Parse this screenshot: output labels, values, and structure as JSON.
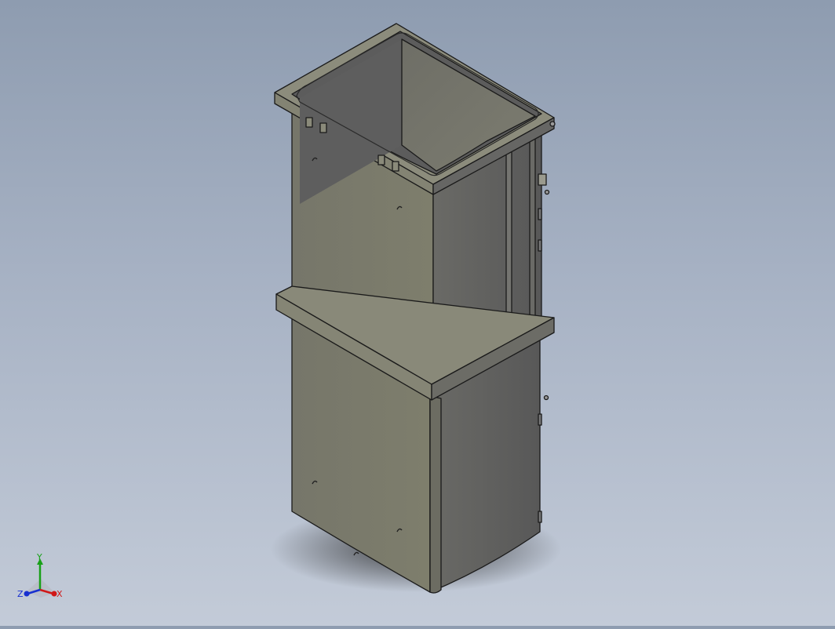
{
  "viewport": {
    "colors": {
      "background_top": "#8e9cb0",
      "background_bottom": "#c3cbd8",
      "part_face_front": "#7b7b6a",
      "part_face_side": "#5f5f5f",
      "part_face_top": "#8b8b7b",
      "edge": "#1a1a1a"
    }
  },
  "triad": {
    "x_label": "X",
    "y_label": "Y",
    "z_label": "Z",
    "colors": {
      "x": "#d01818",
      "y": "#18a018",
      "z": "#1830d0"
    }
  }
}
